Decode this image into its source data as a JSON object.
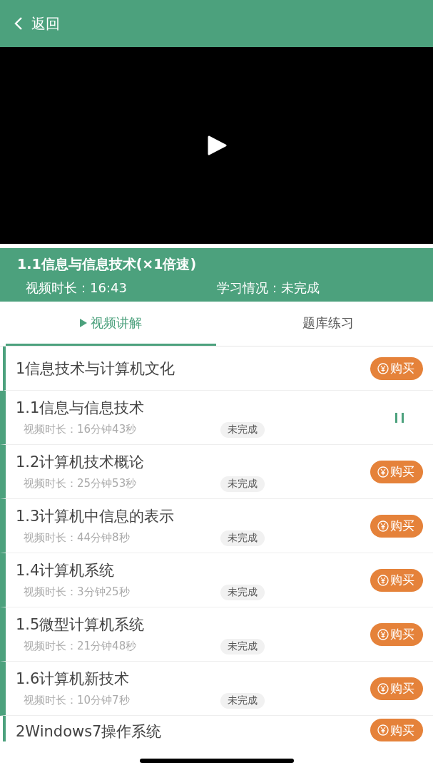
{
  "nav": {
    "back_label": "返回"
  },
  "video": {
    "playing": false
  },
  "info": {
    "title": "1.1信息与信息技术(×1倍速)",
    "duration_label": "视频时长：",
    "duration": "16:43",
    "status_label": "学习情况：",
    "status": "未完成"
  },
  "tabs": [
    {
      "label": "视频讲解",
      "selected": true
    },
    {
      "label": "题库练习",
      "selected": false
    }
  ],
  "sections": [
    {
      "title": "1信息技术与计算机文化",
      "buy_label": "购买",
      "lessons": [
        {
          "title": "1.1信息与信息技术",
          "duration": "视频时长：16分钟43秒",
          "status": "未完成",
          "playing": true
        },
        {
          "title": "1.2计算机技术概论",
          "duration": "视频时长：25分钟53秒",
          "status": "未完成",
          "playing": false,
          "buy_label": "购买"
        },
        {
          "title": "1.3计算机中信息的表示",
          "duration": "视频时长：44分钟8秒",
          "status": "未完成",
          "playing": false,
          "buy_label": "购买"
        },
        {
          "title": "1.4计算机系统",
          "duration": "视频时长：3分钟25秒",
          "status": "未完成",
          "playing": false,
          "buy_label": "购买"
        },
        {
          "title": "1.5微型计算机系统",
          "duration": "视频时长：21分钟48秒",
          "status": "未完成",
          "playing": false,
          "buy_label": "购买"
        },
        {
          "title": "1.6计算机新技术",
          "duration": "视频时长：10分钟7秒",
          "status": "未完成",
          "playing": false,
          "buy_label": "购买"
        }
      ]
    },
    {
      "title": "2Windows7操作系统",
      "buy_label": "购买"
    }
  ]
}
